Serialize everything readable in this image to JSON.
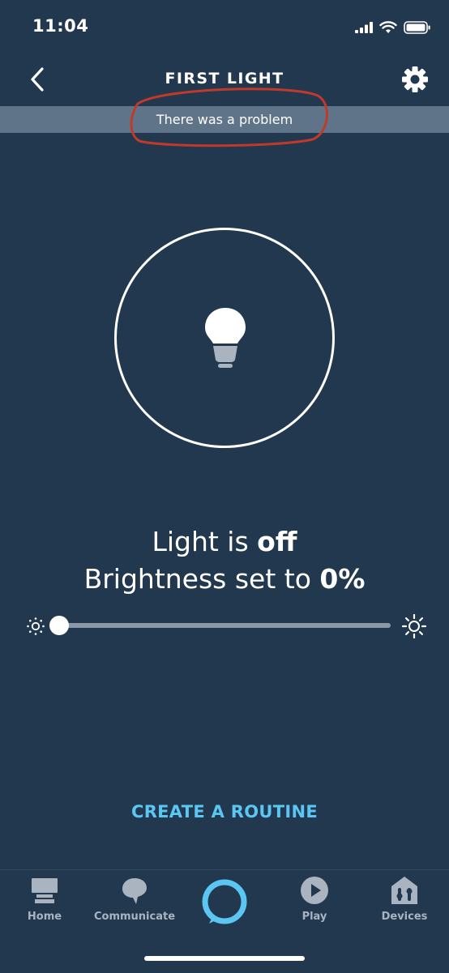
{
  "status_bar": {
    "time": "11:04"
  },
  "header": {
    "title": "FIRST LIGHT"
  },
  "banner": {
    "message": "There was a problem"
  },
  "light": {
    "state_prefix": "Light is ",
    "state_value": "off",
    "brightness_prefix": "Brightness set to ",
    "brightness_value": "0%",
    "brightness_fraction": 0
  },
  "routine": {
    "label": "CREATE A ROUTINE"
  },
  "nav": {
    "items": [
      {
        "label": "Home",
        "icon": "home-icon"
      },
      {
        "label": "Communicate",
        "icon": "communicate-icon"
      },
      {
        "label": "",
        "icon": "alexa-icon"
      },
      {
        "label": "Play",
        "icon": "play-icon"
      },
      {
        "label": "Devices",
        "icon": "devices-icon"
      }
    ]
  },
  "colors": {
    "background": "#22384f",
    "banner": "#607489",
    "accent": "#5bc6f2",
    "annotation": "#c0392b"
  }
}
